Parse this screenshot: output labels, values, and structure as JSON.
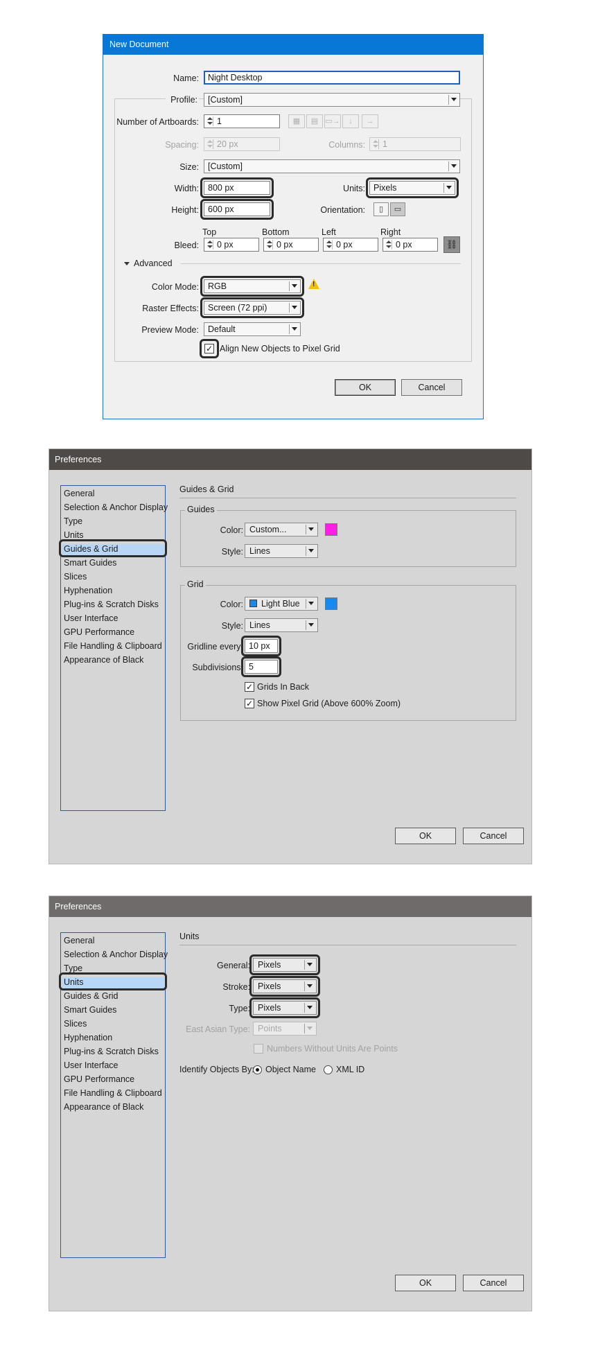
{
  "colors": {
    "titlebar_blue": "#0878d7",
    "pref_titlebar_1": "#4e4a48",
    "pref_titlebar_2": "#6e6b6a",
    "guides_color": "#ff1ee6",
    "grid_color": "#1589ef",
    "selected_item": "#b8d6f5",
    "highlight_ring": "#2b2b2b",
    "warning": "#f3c200"
  },
  "new_document": {
    "title": "New Document",
    "name_label": "Name:",
    "name_value": "Night Desktop",
    "profile_label": "Profile:",
    "profile_value": "[Custom]",
    "artboards_label": "Number of Artboards:",
    "artboards_value": "1",
    "spacing_label": "Spacing:",
    "spacing_value": "20 px",
    "columns_label": "Columns:",
    "columns_value": "1",
    "size_label": "Size:",
    "size_value": "[Custom]",
    "width_label": "Width:",
    "width_value": "800 px",
    "units_label": "Units:",
    "units_value": "Pixels",
    "height_label": "Height:",
    "height_value": "600 px",
    "orientation_label": "Orientation:",
    "bleed_label": "Bleed:",
    "bleed": {
      "top_label": "Top",
      "top_value": "0 px",
      "bottom_label": "Bottom",
      "bottom_value": "0 px",
      "left_label": "Left",
      "left_value": "0 px",
      "right_label": "Right",
      "right_value": "0 px"
    },
    "advanced_label": "Advanced",
    "color_mode_label": "Color Mode:",
    "color_mode_value": "RGB",
    "raster_label": "Raster Effects:",
    "raster_value": "Screen (72 ppi)",
    "preview_label": "Preview Mode:",
    "preview_value": "Default",
    "align_label": "Align New Objects to Pixel Grid",
    "align_checked": true,
    "ok_label": "OK",
    "cancel_label": "Cancel"
  },
  "preferences_categories": [
    "General",
    "Selection & Anchor Display",
    "Type",
    "Units",
    "Guides & Grid",
    "Smart Guides",
    "Slices",
    "Hyphenation",
    "Plug-ins & Scratch Disks",
    "User Interface",
    "GPU Performance",
    "File Handling & Clipboard",
    "Appearance of Black"
  ],
  "pref_guides": {
    "title": "Preferences",
    "selected_category": "Guides & Grid",
    "section_title": "Guides & Grid",
    "guides_group": "Guides",
    "guides_color_label": "Color:",
    "guides_color_value": "Custom...",
    "guides_style_label": "Style:",
    "guides_style_value": "Lines",
    "grid_group": "Grid",
    "grid_color_label": "Color:",
    "grid_color_value": "Light Blue",
    "grid_style_label": "Style:",
    "grid_style_value": "Lines",
    "gridline_label": "Gridline every:",
    "gridline_value": "10 px",
    "subdivisions_label": "Subdivisions:",
    "subdivisions_value": "5",
    "grids_in_back_label": "Grids In Back",
    "show_pixel_grid_label": "Show Pixel Grid (Above 600% Zoom)",
    "ok_label": "OK",
    "cancel_label": "Cancel"
  },
  "pref_units": {
    "title": "Preferences",
    "selected_category": "Units",
    "section_title": "Units",
    "general_label": "General:",
    "general_value": "Pixels",
    "stroke_label": "Stroke:",
    "stroke_value": "Pixels",
    "type_label": "Type:",
    "type_value": "Pixels",
    "east_asian_label": "East Asian Type:",
    "east_asian_value": "Points",
    "numbers_label": "Numbers Without Units Are Points",
    "identify_label": "Identify Objects By:",
    "object_name_label": "Object Name",
    "xml_id_label": "XML ID",
    "ok_label": "OK",
    "cancel_label": "Cancel"
  }
}
